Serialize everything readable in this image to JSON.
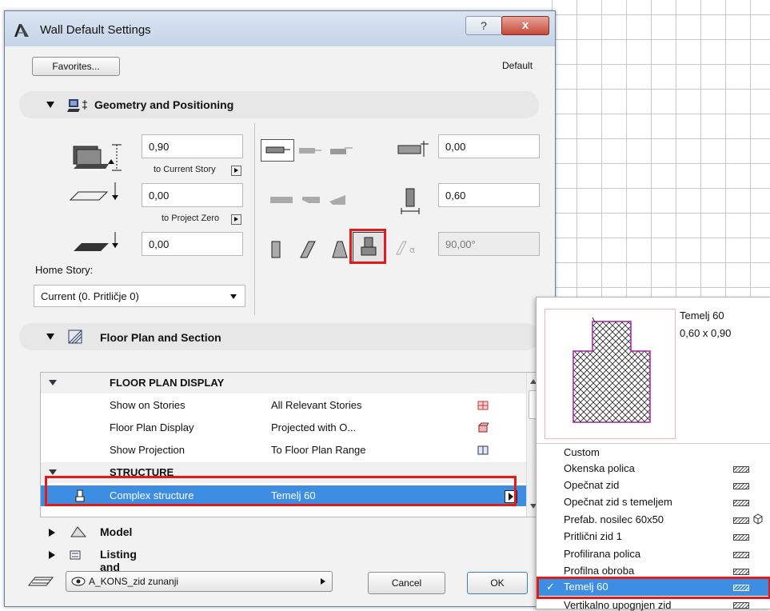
{
  "window": {
    "title": "Wall Default Settings",
    "help_glyph": "?",
    "close_glyph": "x"
  },
  "top": {
    "favorites_label": "Favorites...",
    "default_label": "Default"
  },
  "geometry": {
    "header": "Geometry and Positioning",
    "top_value": "0,90",
    "top_link": "to Current Story",
    "bottom_value": "0,00",
    "bottom_link": "to Project Zero",
    "base_value": "0,00",
    "home_story_label": "Home Story:",
    "home_story_value": "Current (0. Pritličje 0)",
    "offset_value": "0,00",
    "thickness_value": "0,60",
    "angle_value": "90,00°"
  },
  "floorplan": {
    "header": "Floor Plan and Section",
    "cat1": "FLOOR PLAN DISPLAY",
    "rows": [
      {
        "name": "Show on Stories",
        "value": "All Relevant Stories"
      },
      {
        "name": "Floor Plan Display",
        "value": "Projected with O..."
      },
      {
        "name": "Show Projection",
        "value": "To Floor Plan Range"
      }
    ],
    "cat2": "STRUCTURE",
    "selected": {
      "name": "Complex structure",
      "value": "Temelj 60"
    }
  },
  "sections": {
    "model": "Model",
    "listing": "Listing and Labeling"
  },
  "bottom": {
    "layer": "A_KONS_zid zunanji",
    "cancel": "Cancel",
    "ok": "OK"
  },
  "popup": {
    "preview_name": "Temelj 60",
    "preview_size": "0,60 x 0,90",
    "custom": "Custom",
    "items": [
      "Okenska polica",
      "Opečnat zid",
      "Opečnat zid s temeljem",
      "Prefab. nosilec 60x50",
      "Pritlični zid 1",
      "Profilirana polica",
      "Profilna obroba",
      "Temelj 60",
      "Vertikalno upognjen zid"
    ],
    "check": "✓"
  }
}
